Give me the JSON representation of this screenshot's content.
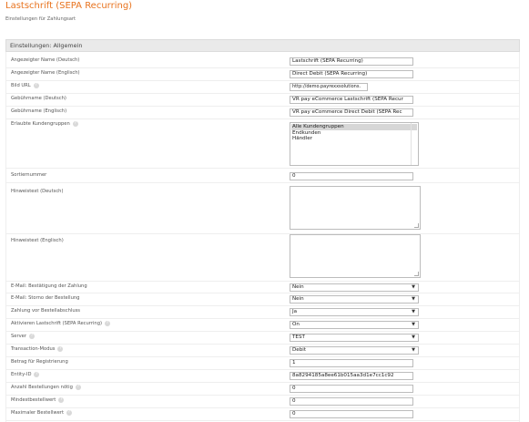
{
  "header": {
    "title": "Lastschrift (SEPA Recurring)",
    "subtitle": "Einstellungen für Zahlungsart"
  },
  "section": {
    "title": "Einstellungen: Allgemein"
  },
  "fields": {
    "name_de": {
      "label": "Angezeigter Name (Deutsch)",
      "value": "Lastschrift (SEPA Recurring)"
    },
    "name_en": {
      "label": "Angezeigter Name (Englisch)",
      "value": "Direct Debit (SEPA Recurring)"
    },
    "bild_url": {
      "label": "Bild URL",
      "value": "http://demo.payrexxsolutions."
    },
    "gebuehr_de": {
      "label": "Gebührname (Deutsch)",
      "value": "VR pay eCommerce Lastschrift (SEPA Recur"
    },
    "gebuehr_en": {
      "label": "Gebührname (Englisch)",
      "value": "VR pay eCommerce Direct Debit (SEPA Rec"
    },
    "kundengruppen": {
      "label": "Erlaubte Kundengruppen",
      "options": [
        "Alle Kundengruppen",
        "Endkunden",
        "Händler"
      ],
      "selected": "Alle Kundengruppen"
    },
    "sortiernummer": {
      "label": "Sortiernummer",
      "value": "0"
    },
    "hinweis_de": {
      "label": "Hinweistext (Deutsch)",
      "value": ""
    },
    "hinweis_en": {
      "label": "Hinweistext (Englisch)",
      "value": ""
    },
    "email_bestaetigung": {
      "label": "E-Mail: Bestätigung der Zahlung",
      "value": "Nein"
    },
    "email_storno": {
      "label": "E-Mail: Storno der Bestellung",
      "value": "Nein"
    },
    "zahlung_vor": {
      "label": "Zahlung vor Bestellabschluss",
      "value": "Ja"
    },
    "aktivieren": {
      "label": "Aktivieren Lastschrift (SEPA Recurring)",
      "value": "On"
    },
    "server": {
      "label": "Server",
      "value": "TEST"
    },
    "transaction_modus": {
      "label": "Transaction-Modus",
      "value": "Debit"
    },
    "betrag_registrierung": {
      "label": "Betrag für Registrierung",
      "value": "1"
    },
    "entity_id": {
      "label": "Entity-ID",
      "value": "8a8294185a8ee61b015aa3d1e7cc1c92"
    },
    "anzahl_bestellungen": {
      "label": "Anzahl Bestellungen nötig",
      "value": "0"
    },
    "mindestbestellwert": {
      "label": "Mindestbestellwert",
      "value": "0"
    },
    "maximaler_bestellwert": {
      "label": "Maximaler Bestellwert",
      "value": "0"
    }
  },
  "icons": {
    "help": "help-circle-icon",
    "dropdown": "chevron-down-icon"
  },
  "colors": {
    "title": "#e8731e",
    "section_bg": "#eaeaea",
    "selected_option": "#d7d7d7"
  }
}
